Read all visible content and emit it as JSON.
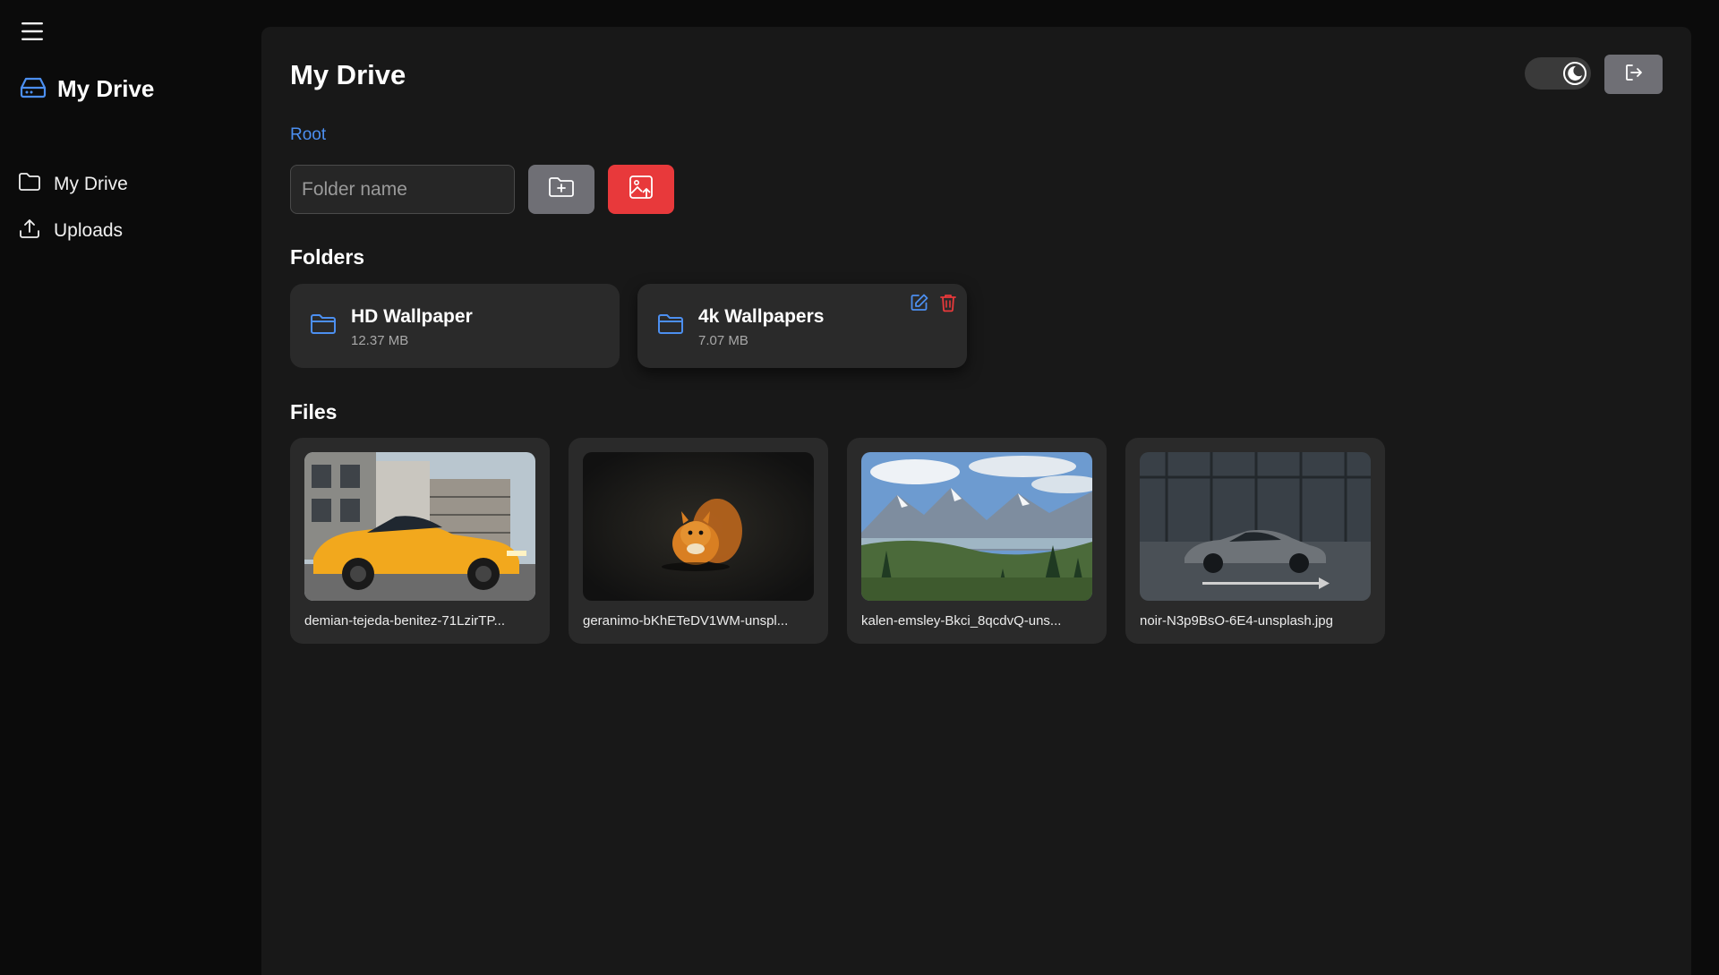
{
  "sidebar": {
    "menu_icon": "hamburger-icon",
    "brand": {
      "icon": "hard-drive-icon",
      "title": "My Drive"
    },
    "items": [
      {
        "label": "My Drive",
        "icon": "folder-icon"
      },
      {
        "label": "Uploads",
        "icon": "upload-icon"
      }
    ]
  },
  "header": {
    "title": "My Drive",
    "theme_toggle_icon": "moon-icon",
    "theme": "dark",
    "logout_icon": "logout-icon"
  },
  "breadcrumb": {
    "items": [
      "Root"
    ]
  },
  "create": {
    "folder_name_placeholder": "Folder name",
    "folder_name_value": "",
    "create_folder_icon": "folder-plus-icon",
    "upload_icon": "image-upload-icon"
  },
  "folders": {
    "title": "Folders",
    "items": [
      {
        "name": "HD Wallpaper",
        "size": "12.37 MB"
      },
      {
        "name": "4k Wallpapers",
        "size": "7.07 MB",
        "actions": [
          "edit-icon",
          "trash-icon"
        ]
      }
    ]
  },
  "files": {
    "title": "Files",
    "items": [
      {
        "name": "demian-tejeda-benitez-71LzirTP...",
        "thumbnail": "yellow sports car in front of buildings"
      },
      {
        "name": "geranimo-bKhETeDV1WM-unspl...",
        "thumbnail": "orange squirrel on dark background"
      },
      {
        "name": "kalen-emsley-Bkci_8qcdvQ-uns...",
        "thumbnail": "mountain valley landscape"
      },
      {
        "name": "noir-N3p9BsO-6E4-unsplash.jpg",
        "thumbnail": "grey sports car on dark street"
      }
    ]
  },
  "colors": {
    "accent": "#4c8ff0",
    "danger": "#e8393b",
    "button_gray": "#6f6f75",
    "panel": "#181818",
    "card": "#2a2a2a",
    "background": "#0b0b0b"
  }
}
